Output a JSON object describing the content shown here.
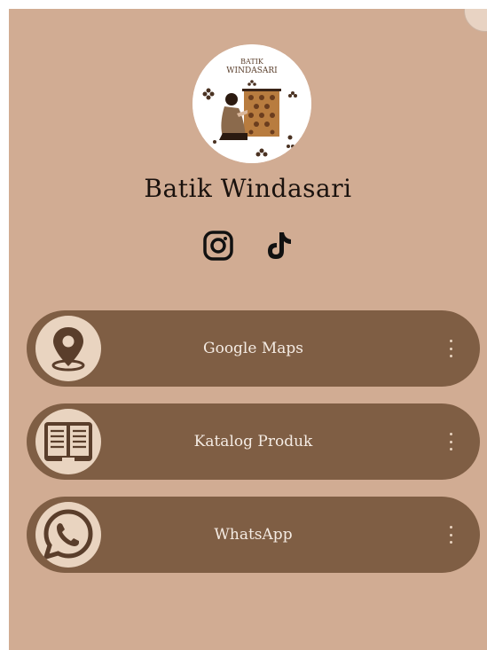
{
  "profile": {
    "name": "Batik Windasari",
    "logo_text_top": "BATIK",
    "logo_text_bottom": "WINDASARI"
  },
  "socials": [
    {
      "icon": "instagram-icon"
    },
    {
      "icon": "tiktok-icon"
    }
  ],
  "links": [
    {
      "label": "Google Maps",
      "icon": "map-pin-icon"
    },
    {
      "label": "Katalog Produk",
      "icon": "book-icon"
    },
    {
      "label": "WhatsApp",
      "icon": "whatsapp-icon"
    }
  ],
  "colors": {
    "background": "#d1ac93",
    "button": "#7f5e44",
    "button_text": "#f4ebe3",
    "thumb_bg": "#e9d4c0",
    "icon_dark": "#5a3e2b"
  }
}
